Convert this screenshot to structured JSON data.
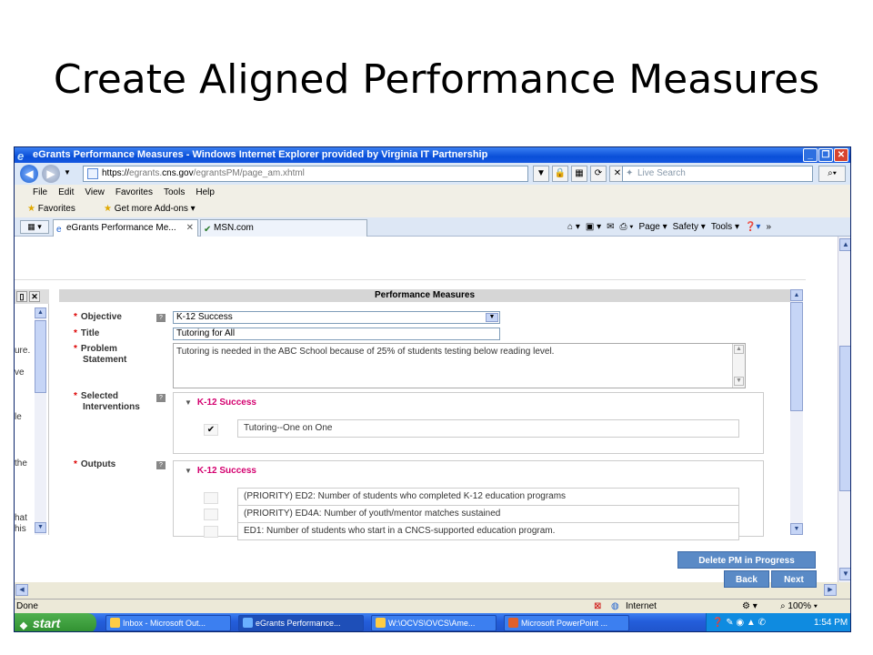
{
  "slide": {
    "title": "Create Aligned Performance Measures"
  },
  "window": {
    "title": "eGrants Performance Measures - Windows Internet Explorer provided by Virginia IT Partnership"
  },
  "address": {
    "prefix": "https://",
    "domain_pre": "egrants.",
    "domain": "cns.gov",
    "path": "/egrantsPM/page_am.xhtml"
  },
  "search": {
    "placeholder": "Live Search"
  },
  "menu": [
    "File",
    "Edit",
    "View",
    "Favorites",
    "Tools",
    "Help"
  ],
  "favorites": {
    "label": "Favorites",
    "addons": "Get more Add-ons"
  },
  "tabs": [
    {
      "label": "eGrants Performance Me..."
    },
    {
      "label": "MSN.com"
    }
  ],
  "commands": [
    "Page",
    "Safety",
    "Tools"
  ],
  "left_panel": {
    "snippets": [
      "ure.",
      "ve",
      "le",
      "the",
      "hat",
      "his"
    ]
  },
  "form": {
    "section_title": "Performance Measures",
    "objective": {
      "label": "Objective",
      "value": "K-12 Success"
    },
    "title": {
      "label": "Title",
      "value": "Tutoring for All"
    },
    "problem": {
      "label_line1": "Problem",
      "label_line2": "Statement",
      "value": "Tutoring is needed in the ABC School because of 25% of students testing below reading level."
    },
    "interventions": {
      "label_line1": "Selected",
      "label_line2": "Interventions",
      "group": "K-12 Success",
      "items": [
        {
          "label": "Tutoring--One on One",
          "checked": true
        }
      ]
    },
    "outputs": {
      "label": "Outputs",
      "group": "K-12 Success",
      "items": [
        {
          "label": "(PRIORITY) ED2: Number of students who completed K-12 education programs",
          "checked": false
        },
        {
          "label": "(PRIORITY) ED4A: Number of youth/mentor matches sustained",
          "checked": false
        },
        {
          "label": "ED1: Number of students who start in a CNCS-supported education program.",
          "checked": false
        }
      ]
    }
  },
  "buttons": {
    "delete": "Delete PM in Progress",
    "back": "Back",
    "next": "Next"
  },
  "status": {
    "left": "Done",
    "zone": "Internet",
    "zoom": "100%"
  },
  "taskbar": {
    "start": "start",
    "tasks": [
      "Inbox - Microsoft Out...",
      "eGrants Performance...",
      "W:\\OCVS\\OVCS\\Ame...",
      "Microsoft PowerPoint ..."
    ],
    "time": "1:54 PM"
  }
}
